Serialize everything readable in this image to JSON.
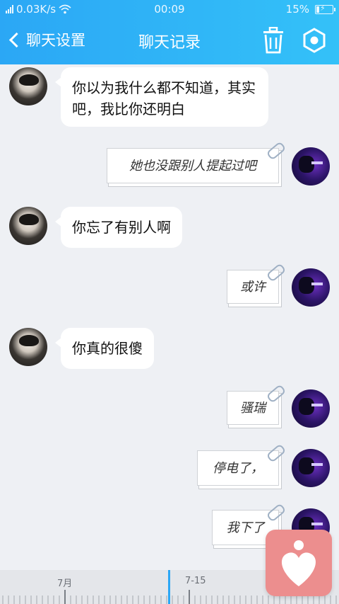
{
  "status_bar": {
    "network_speed": "0.03K/s",
    "time": "00:09",
    "battery": "15%"
  },
  "nav": {
    "back_label": "聊天设置",
    "title": "聊天记录"
  },
  "icons": {
    "back": "chevron-left-icon",
    "trash": "trash-icon",
    "settings": "hexagon-gear-icon",
    "float": "heart-person-icon"
  },
  "messages": [
    {
      "side": "left",
      "kind": "bubble",
      "text": "你以为我什么都不知道，其实吧，我比你还明白"
    },
    {
      "side": "right",
      "kind": "note",
      "text": "她也没跟别人提起过吧"
    },
    {
      "side": "left",
      "kind": "bubble",
      "text": "你忘了有别人啊"
    },
    {
      "side": "right",
      "kind": "note",
      "text": "或许"
    },
    {
      "side": "left",
      "kind": "bubble",
      "text": "你真的很傻"
    },
    {
      "side": "right",
      "kind": "note",
      "text": "骚瑞"
    },
    {
      "side": "right",
      "kind": "note",
      "text": "停电了，"
    },
    {
      "side": "right",
      "kind": "note",
      "text": "我下了"
    }
  ],
  "timeline": {
    "labels": [
      "7月",
      "7-15"
    ]
  },
  "colors": {
    "header": "#2ba7f5",
    "accent": "#2ba7f5",
    "float_button": "#ec8e8e",
    "background": "#eef0f4"
  }
}
